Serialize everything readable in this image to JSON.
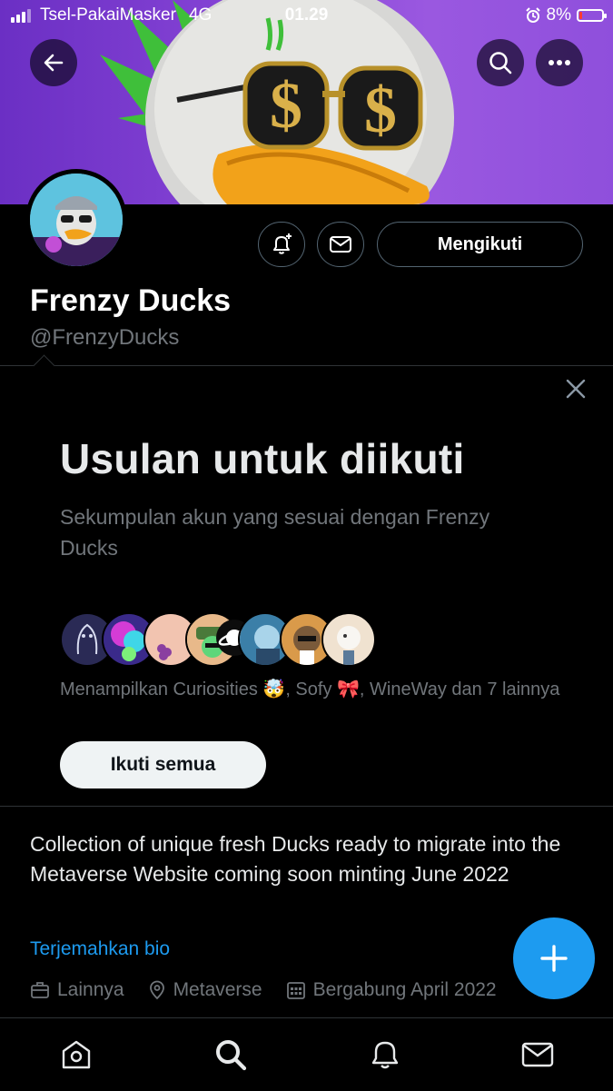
{
  "status_bar": {
    "carrier": "Tsel-PakaiMasker",
    "network": "4G",
    "time": "01.29",
    "battery": "8%"
  },
  "header_buttons": {
    "back_icon": "arrow-left-icon",
    "search_icon": "search-icon",
    "more_icon": "more-horizontal-icon"
  },
  "profile": {
    "name": "Frenzy Ducks",
    "handle": "@FrenzyDucks",
    "follow_label": "Mengikuti",
    "notify_icon": "bell-plus-icon",
    "message_icon": "mail-icon"
  },
  "suggestions": {
    "title": "Usulan untuk diikuti",
    "subtitle": "Sekumpulan akun yang sesuai dengan Frenzy Ducks",
    "showing_text": "Menampilkan Curiosities 🤯, Sofy 🎀, WineWay dan 7 lainnya",
    "follow_all_label": "Ikuti semua",
    "avatar_colors": [
      "#2a2a55",
      "#3a2a8a",
      "#f2c4b0",
      "#e8b98a",
      "#0d0d0d",
      "#3b7fa8",
      "#d99a4a",
      "#f0e2d0"
    ]
  },
  "bio": {
    "text": "Collection of unique fresh Ducks ready to migrate into the Metaverse Website coming soon minting June 2022",
    "translate_label": "Terjemahkan bio",
    "category": "Lainnya",
    "location": "Metaverse",
    "joined": "Bergabung April 2022"
  },
  "bottom_nav": {
    "items": [
      "home-icon",
      "search-icon",
      "notifications-icon",
      "messages-icon"
    ]
  },
  "colors": {
    "accent": "#1d9bf0",
    "background": "#000000",
    "muted_text": "#71767b"
  }
}
